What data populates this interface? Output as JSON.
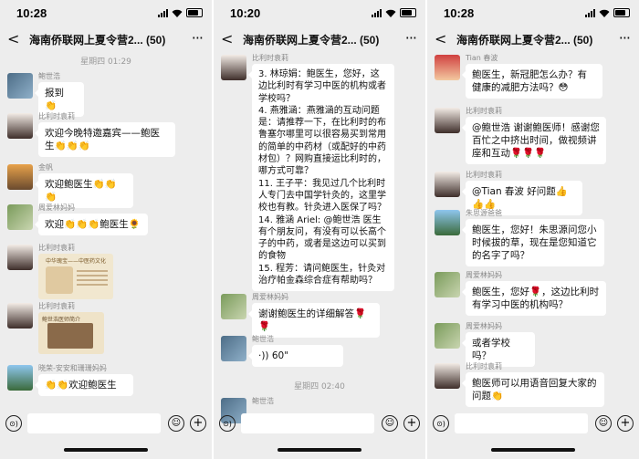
{
  "panels": [
    {
      "time": "10:28",
      "title": "海南侨联网上夏令营2... (50)",
      "timestamp": "星期四 01:29",
      "messages": [
        {
          "name": "鲍世浩",
          "text": "报到 👏"
        },
        {
          "name": "比利时袁莉",
          "text": "欢迎今晚特邀嘉宾——鲍医生👏👏👏"
        },
        {
          "name": "金帆",
          "text": "欢迎鲍医生👏👏👏"
        },
        {
          "name": "周爱林妈妈",
          "text": "欢迎👏👏👏鲍医生🌻"
        },
        {
          "name": "比利时袁莉",
          "card_title": "中华瑰宝——中医药文化"
        },
        {
          "name": "比利时袁莉",
          "card_title": "鲍世浩医师简介"
        },
        {
          "name": "晓荣-安安和珊珊妈妈",
          "text": "👏👏欢迎鲍医生"
        }
      ]
    },
    {
      "time": "10:20",
      "title": "海南侨联网上夏令营2... (50)",
      "timestamp": "星期四 02:40",
      "messages": [
        {
          "name": "比利时袁莉",
          "text": "3. 林琼娟：鲍医生，您好，这边比利时有学习中医的机构或者学校吗？\n4. 燕雅涵：燕雅涵的互动问题是：请推荐一下，在比利时的布鲁塞尔哪里可以很容易买到常用的简单的中药材（或配好的中药材包）？网购直接运比利时的，哪方式可靠？\n11. 王子平：我见过几个比利时人专门去中国学针灸的，这里学校也有教。针灸进入医保了吗？\n14. 雅涵 Ariel: @鲍世浩 医生 有个朋友问，有没有可以长高个子的中药，或者是这边可以买到的食物\n15. 程芳：请问鲍医生，针灸对治疗帕金森综合症有帮助吗？"
        },
        {
          "name": "周爱林妈妈",
          "text": "谢谢鲍医生的详细解答🌹🌹"
        },
        {
          "name": "鲍世浩",
          "voice": "60\""
        },
        {
          "name": "鲍世浩",
          "text": ""
        }
      ]
    },
    {
      "time": "10:28",
      "title": "海南侨联网上夏令营2... (50)",
      "messages": [
        {
          "name": "Tian 春波",
          "text": "鲍医生，新冠肥怎么办？有健康的减肥方法吗？😳"
        },
        {
          "name": "比利时袁莉",
          "text": "@鲍世浩 谢谢鲍医师！感谢您百忙之中挤出时间，做视频讲座和互动🌹🌹🌹"
        },
        {
          "name": "比利时袁莉",
          "text": "@Tian 春波 好问题👍👍👍"
        },
        {
          "name": "朱思源爸爸",
          "text": "鲍医生，您好！朱思源问您小时候拔的草，现在是您知道它的名字了吗？"
        },
        {
          "name": "周爱林妈妈",
          "text": "鲍医生，您好🌹，这边比利时有学习中医的机构吗？"
        },
        {
          "name": "周爱林妈妈",
          "text": "或者学校吗？"
        },
        {
          "name": "比利时袁莉",
          "text": "鲍医师可以用语音回复大家的问题👏"
        }
      ]
    }
  ],
  "icons": {
    "back": "<",
    "more": "···",
    "voice_input": "⊙)",
    "emoji": "☺",
    "plus": "+",
    "voice_wave": "·))"
  }
}
